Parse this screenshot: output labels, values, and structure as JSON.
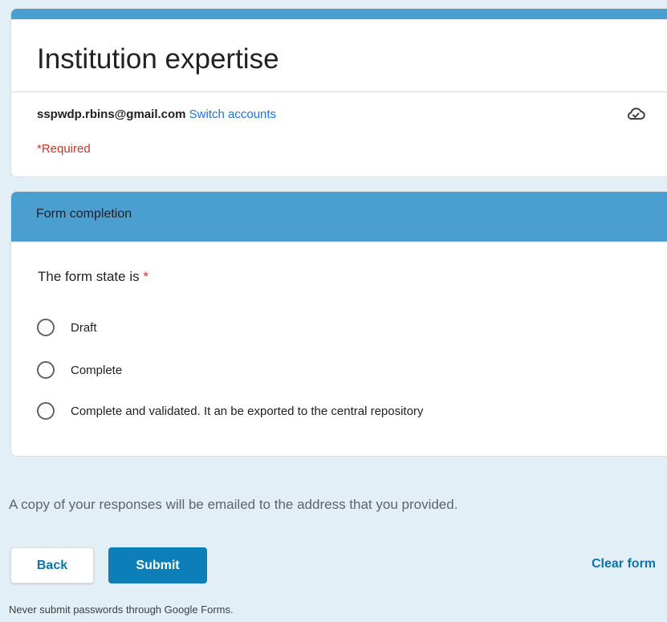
{
  "form": {
    "title": "Institution expertise",
    "account_email": "sspwdp.rbins@gmail.com",
    "switch_accounts": "Switch accounts",
    "required_note": "*Required"
  },
  "section": {
    "title": "Form completion",
    "question": {
      "label": "The form state is",
      "required_marker": "*",
      "options": [
        "Draft",
        "Complete",
        "Complete and validated. It an be exported to the central repository"
      ]
    }
  },
  "footer": {
    "copy_note": "A copy of your responses will be emailed to the address that you provided.",
    "back_label": "Back",
    "submit_label": "Submit",
    "clear_label": "Clear form",
    "password_note": "Never submit passwords through Google Forms."
  },
  "icons": {
    "save_status": "cloud-done-icon"
  },
  "colors": {
    "accent": "#4a9fd0",
    "primary_button": "#0c7fb8",
    "link": "#1a73e8",
    "required": "#d93025",
    "background": "#e3eff6"
  }
}
